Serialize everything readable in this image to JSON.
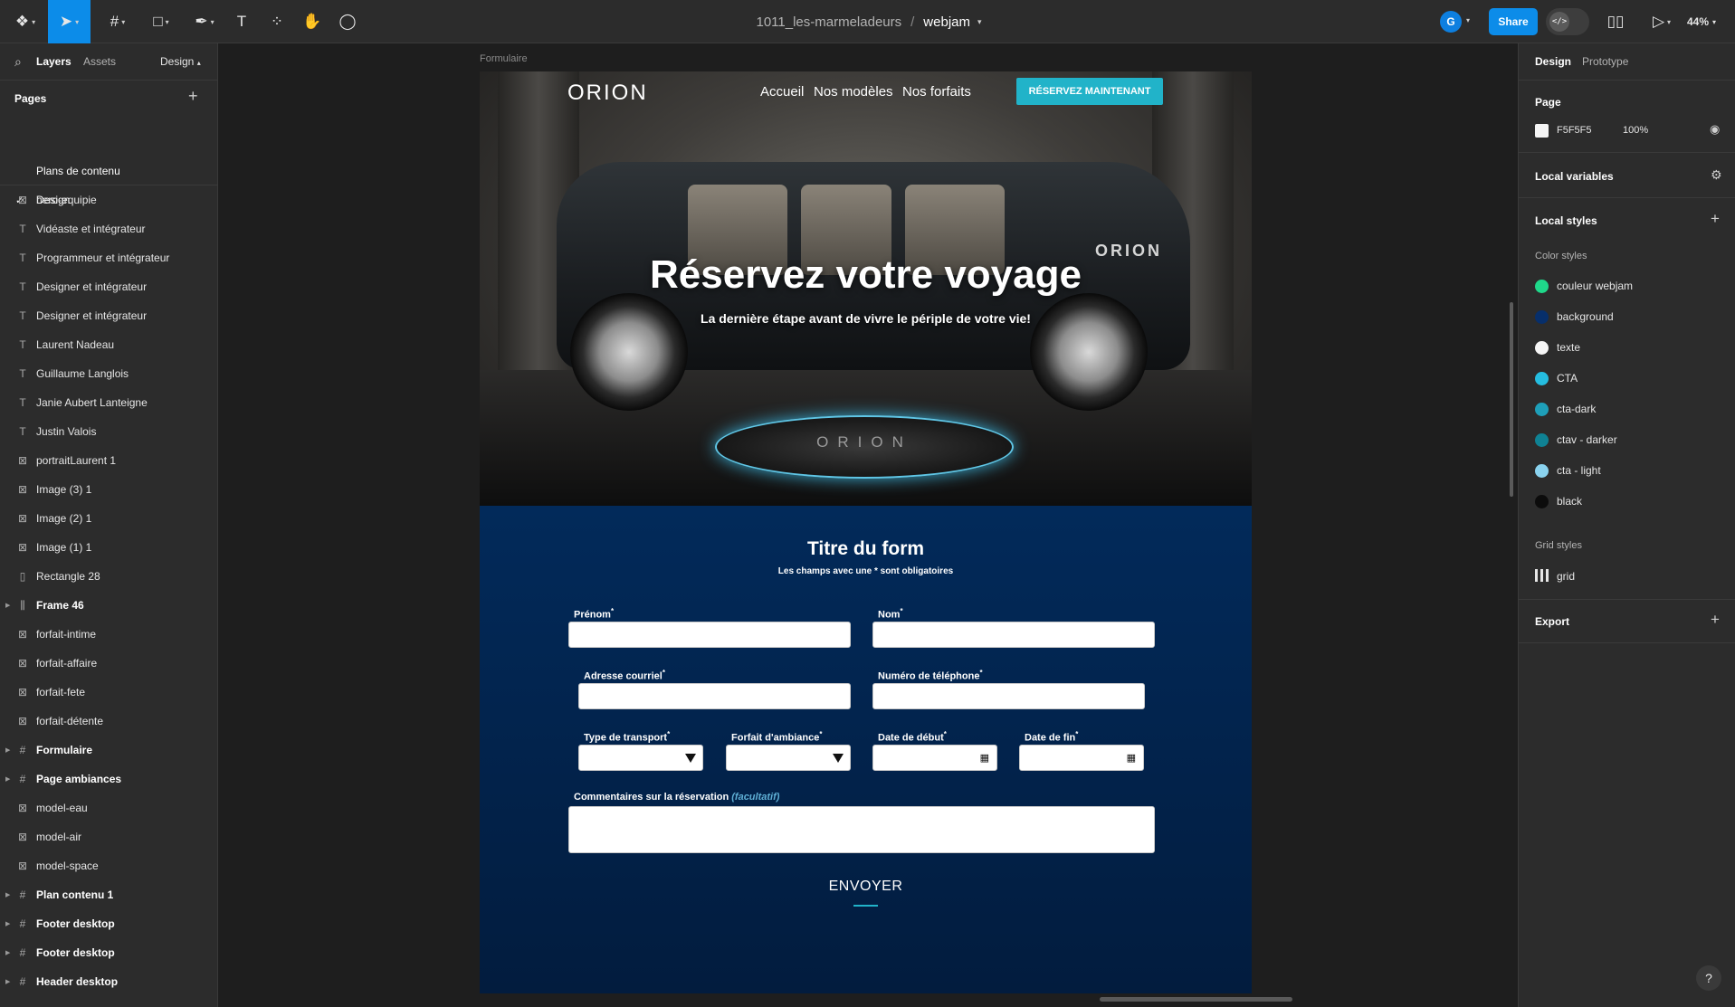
{
  "toolbar": {
    "project": "1011_les-marmeladeurs",
    "separator": "/",
    "file": "webjam",
    "avatar_initial": "G",
    "share_label": "Share",
    "devmode_glyph": "</>",
    "zoom": "44%"
  },
  "left_panel": {
    "tabs": {
      "layers": "Layers",
      "assets": "Assets",
      "design": "Design"
    },
    "pages_title": "Pages",
    "pages": [
      {
        "label": "Plans de contenu",
        "checked": false
      },
      {
        "label": "Design",
        "checked": true
      }
    ],
    "layers": [
      {
        "label": "hero-equipie",
        "kind": "image",
        "frame": false
      },
      {
        "label": "Vidéaste et intégrateur",
        "kind": "text",
        "frame": false
      },
      {
        "label": "Programmeur et intégrateur",
        "kind": "text",
        "frame": false
      },
      {
        "label": "Designer et intégrateur",
        "kind": "text",
        "frame": false
      },
      {
        "label": "Designer et intégrateur",
        "kind": "text",
        "frame": false
      },
      {
        "label": "Laurent Nadeau",
        "kind": "text",
        "frame": false
      },
      {
        "label": "Guillaume Langlois",
        "kind": "text",
        "frame": false
      },
      {
        "label": "Janie Aubert Lanteigne",
        "kind": "text",
        "frame": false
      },
      {
        "label": "Justin Valois",
        "kind": "text",
        "frame": false
      },
      {
        "label": "portraitLaurent 1",
        "kind": "image",
        "frame": false
      },
      {
        "label": "Image (3) 1",
        "kind": "image",
        "frame": false
      },
      {
        "label": "Image (2) 1",
        "kind": "image",
        "frame": false
      },
      {
        "label": "Image (1) 1",
        "kind": "image",
        "frame": false
      },
      {
        "label": "Rectangle 28",
        "kind": "rect",
        "frame": false
      },
      {
        "label": "Frame 46",
        "kind": "autolayout",
        "frame": true
      },
      {
        "label": "forfait-intime",
        "kind": "image",
        "frame": false
      },
      {
        "label": "forfait-affaire",
        "kind": "image",
        "frame": false
      },
      {
        "label": "forfait-fete",
        "kind": "image",
        "frame": false
      },
      {
        "label": "forfait-détente",
        "kind": "image",
        "frame": false
      },
      {
        "label": "Formulaire",
        "kind": "frame",
        "frame": true
      },
      {
        "label": "Page ambiances",
        "kind": "frame",
        "frame": true
      },
      {
        "label": "model-eau",
        "kind": "image",
        "frame": false
      },
      {
        "label": "model-air",
        "kind": "image",
        "frame": false
      },
      {
        "label": "model-space",
        "kind": "image",
        "frame": false
      },
      {
        "label": "Plan contenu 1",
        "kind": "frame",
        "frame": true
      },
      {
        "label": "Footer desktop",
        "kind": "frame",
        "frame": true
      },
      {
        "label": "Footer desktop",
        "kind": "frame",
        "frame": true
      },
      {
        "label": "Header desktop",
        "kind": "frame",
        "frame": true
      }
    ]
  },
  "canvas": {
    "frame_label": "Formulaire",
    "nav": {
      "logo": "ORION",
      "links": [
        "Accueil",
        "Nos modèles",
        "Nos forfaits"
      ],
      "cta": "RÉSERVEZ MAINTENANT"
    },
    "hero": {
      "title": "Réservez votre voyage",
      "subtitle": "La dernière étape avant de vivre le périple de votre vie!",
      "car_brand": "ORION",
      "pedestal_brand": "ORION"
    },
    "form": {
      "title": "Titre du form",
      "note": "Les champs avec une * sont obligatoires",
      "fields": {
        "prenom": "Prénom",
        "nom": "Nom",
        "email": "Adresse courriel",
        "phone": "Numéro de téléphone",
        "transport": "Type de transport",
        "ambiance": "Forfait d'ambiance",
        "start": "Date de début",
        "end": "Date de fin",
        "comments": "Commentaires sur la réservation",
        "comments_optional": "(facultatif)"
      },
      "required_mark": "*",
      "calendar_glyph": "▦",
      "submit": "ENVOYER"
    }
  },
  "right_panel": {
    "tabs": {
      "design": "Design",
      "prototype": "Prototype"
    },
    "page_title": "Page",
    "page_color": "F5F5F5",
    "page_opacity": "100%",
    "local_variables": "Local variables",
    "local_styles": "Local styles",
    "color_styles_title": "Color styles",
    "color_styles": [
      {
        "label": "couleur webjam",
        "color": "#1fd88a"
      },
      {
        "label": "background",
        "color": "#072f6b"
      },
      {
        "label": "texte",
        "color": "#f5f5f5"
      },
      {
        "label": "CTA",
        "color": "#25bde0"
      },
      {
        "label": "cta-dark",
        "color": "#1e9fb9"
      },
      {
        "label": "ctav - darker",
        "color": "#0f8294"
      },
      {
        "label": "cta - light",
        "color": "#8ad3ef"
      },
      {
        "label": "black",
        "color": "#0c0c0c"
      }
    ],
    "grid_styles_title": "Grid styles",
    "grid_style": "grid",
    "export": "Export"
  },
  "help_label": "?"
}
